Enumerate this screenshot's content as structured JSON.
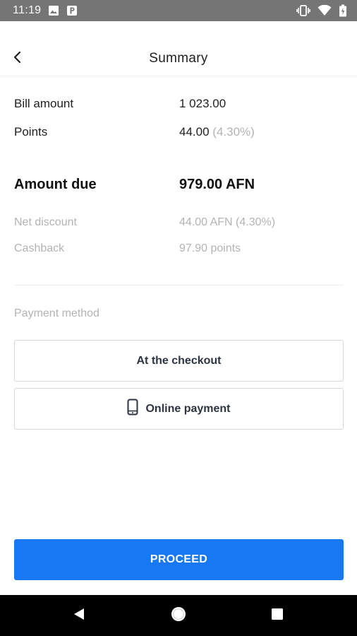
{
  "status_bar": {
    "time": "11:19",
    "left_icons": [
      "image-icon",
      "parking-icon"
    ],
    "right_icons": [
      "vibrate-icon",
      "wifi-icon",
      "battery-icon"
    ]
  },
  "header": {
    "title": "Summary",
    "back_icon": "back-arrow-icon"
  },
  "summary": {
    "bill_amount": {
      "label": "Bill amount",
      "value": "1 023.00"
    },
    "points": {
      "label": "Points",
      "value": "44.00",
      "percent": "(4.30%)"
    },
    "amount_due": {
      "label": "Amount due",
      "value": "979.00 AFN"
    },
    "net_discount": {
      "label": "Net discount",
      "value": "44.00 AFN (4.30%)"
    },
    "cashback": {
      "label": "Cashback",
      "value": "97.90 points"
    }
  },
  "payment": {
    "section_label": "Payment method",
    "options": [
      {
        "label": "At the checkout",
        "icon": ""
      },
      {
        "label": "Online payment",
        "icon": "smartphone-icon"
      }
    ]
  },
  "proceed_label": "PROCEED",
  "nav_bar": {
    "icons": [
      "back-triangle-icon",
      "home-circle-icon",
      "recents-square-icon"
    ]
  },
  "colors": {
    "status_bar": "#757575",
    "accent": "#1877f2",
    "muted_text": "#b3b3b3",
    "nav_bar": "#000000"
  }
}
